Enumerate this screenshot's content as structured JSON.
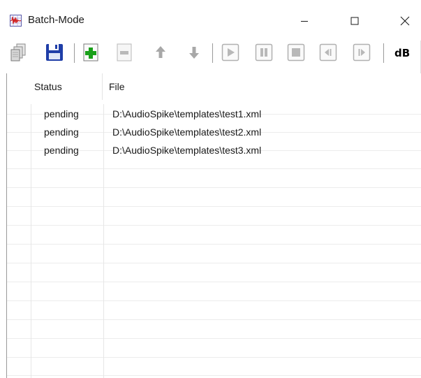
{
  "window": {
    "title": "Batch-Mode"
  },
  "toolbar": {
    "db_label": "dB"
  },
  "table": {
    "columns": [
      "Status",
      "File"
    ],
    "rows": [
      {
        "status": "pending",
        "file": "D:\\AudioSpike\\templates\\test1.xml"
      },
      {
        "status": "pending",
        "file": "D:\\AudioSpike\\templates\\test2.xml"
      },
      {
        "status": "pending",
        "file": "D:\\AudioSpike\\templates\\test3.xml"
      }
    ]
  },
  "colors": {
    "accent_green": "#1aa01a",
    "save_blue": "#1f3ea8",
    "disabled_gray": "#b8b8b8"
  }
}
